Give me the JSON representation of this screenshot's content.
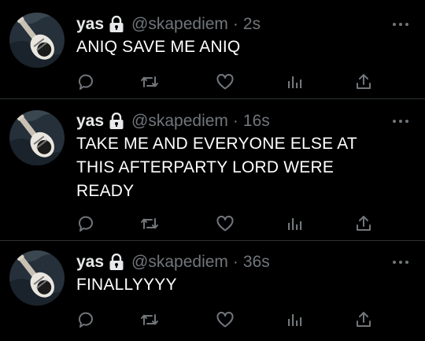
{
  "tweets": [
    {
      "display_name": "yas",
      "handle": "@skapediem",
      "separator": "·",
      "time": "2s",
      "text": "ANIQ SAVE ME ANIQ",
      "actions": [
        "reply-icon",
        "retweet-icon",
        "like-icon",
        "analytics-icon",
        "share-icon"
      ]
    },
    {
      "display_name": "yas",
      "handle": "@skapediem",
      "separator": "·",
      "time": "16s",
      "text": "TAKE ME AND EVERYONE ELSE AT\nTHIS AFTERPARTY LORD WERE\nREADY",
      "actions": [
        "reply-icon",
        "retweet-icon",
        "like-icon",
        "analytics-icon",
        "share-icon"
      ]
    },
    {
      "display_name": "yas",
      "handle": "@skapediem",
      "separator": "·",
      "time": "36s",
      "text": "FINALLYYYY",
      "actions": [
        "reply-icon",
        "retweet-icon",
        "like-icon",
        "analytics-icon",
        "share-icon"
      ]
    }
  ],
  "colors": {
    "background": "#000000",
    "text": "#ffffff",
    "muted": "#71767b",
    "divider": "#2f3336"
  }
}
